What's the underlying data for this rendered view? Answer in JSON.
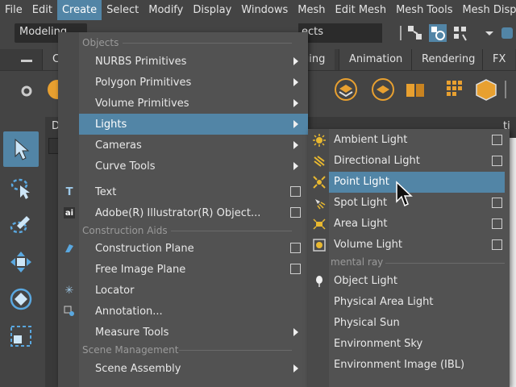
{
  "menubar": {
    "items": [
      "File",
      "Edit",
      "Create",
      "Select",
      "Modify",
      "Display",
      "Windows",
      "Mesh",
      "Edit Mesh",
      "Mesh Tools",
      "Mesh Display"
    ],
    "active": "Create"
  },
  "toolbar": {
    "mode_value": "Modeling",
    "objects_field_value": "ects"
  },
  "shelf": {
    "tabs": [
      "C",
      "ging",
      "Animation",
      "Rendering",
      "FX"
    ]
  },
  "viewport": {
    "panel_label": "D",
    "right_label": "ti"
  },
  "create_menu": {
    "sections": {
      "objects": "Objects",
      "construction_aids": "Construction Aids",
      "scene_management": "Scene Management"
    },
    "items": {
      "nurbs": "NURBS Primitives",
      "polygon": "Polygon Primitives",
      "volume": "Volume Primitives",
      "lights": "Lights",
      "cameras": "Cameras",
      "curve_tools": "Curve Tools",
      "text": "Text",
      "illustrator": "Adobe(R) Illustrator(R) Object...",
      "construction_plane": "Construction Plane",
      "free_image_plane": "Free Image Plane",
      "locator": "Locator",
      "annotation": "Annotation...",
      "measure_tools": "Measure Tools",
      "scene_assembly": "Scene Assembly"
    },
    "icons": {
      "text": "T",
      "illustrator": "ai",
      "locator": "✳"
    }
  },
  "lights_menu": {
    "items": {
      "ambient": "Ambient Light",
      "directional": "Directional Light",
      "point": "Point Light",
      "spot": "Spot Light",
      "area": "Area Light",
      "volume": "Volume Light"
    },
    "section_mental_ray": "mental ray",
    "mr_items": {
      "object_light": "Object Light",
      "physical_area_light": "Physical Area Light",
      "physical_sun": "Physical Sun",
      "environment_sky": "Environment Sky",
      "environment_image": "Environment Image (IBL)"
    }
  },
  "colors": {
    "highlight": "#5285a6",
    "menu_bg": "#525252",
    "app_bg": "#444444",
    "icon_accent": "#e8b830"
  }
}
